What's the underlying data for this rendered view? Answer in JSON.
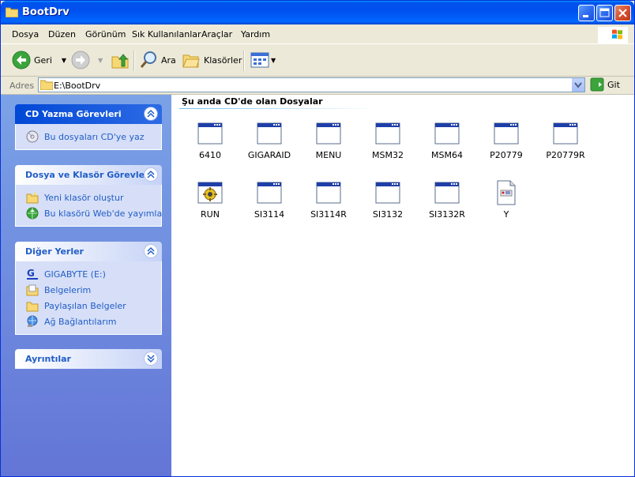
{
  "window": {
    "title": "BootDrv"
  },
  "menu": [
    "Dosya",
    "Düzen",
    "Görünüm",
    "Sık Kullanılanlar",
    "Araçlar",
    "Yardım"
  ],
  "toolbar": {
    "back_label": "Geri",
    "search_label": "Ara",
    "folders_label": "Klasörler"
  },
  "address": {
    "label": "Adres",
    "value": "E:\\BootDrv",
    "go_label": "Git"
  },
  "sidebar": {
    "panels": [
      {
        "title": "CD Yazma Görevleri",
        "items": [
          {
            "label": "Bu dosyaları CD'ye yaz",
            "icon": "cd-burn-icon"
          }
        ]
      },
      {
        "title": "Dosya ve Klasör Görevleri",
        "items": [
          {
            "label": "Yeni klasör oluştur",
            "icon": "new-folder-icon"
          },
          {
            "label": "Bu klasörü Web'de yayımla",
            "icon": "publish-web-icon"
          }
        ]
      },
      {
        "title": "Diğer Yerler",
        "items": [
          {
            "label": "GIGABYTE (E:)",
            "icon": "drive-icon"
          },
          {
            "label": "Belgelerim",
            "icon": "my-documents-icon"
          },
          {
            "label": "Paylaşılan Belgeler",
            "icon": "shared-documents-icon"
          },
          {
            "label": "Ağ Bağlantılarım",
            "icon": "network-icon"
          }
        ]
      },
      {
        "title": "Ayrıntılar",
        "items": []
      }
    ]
  },
  "content": {
    "group_title": "Şu anda CD'de olan Dosyalar",
    "files": [
      {
        "name": "6410",
        "type": "app"
      },
      {
        "name": "GIGARAID",
        "type": "app"
      },
      {
        "name": "MENU",
        "type": "app"
      },
      {
        "name": "MSM32",
        "type": "app"
      },
      {
        "name": "MSM64",
        "type": "app"
      },
      {
        "name": "P20779",
        "type": "app"
      },
      {
        "name": "P20779R",
        "type": "app"
      },
      {
        "name": "RUN",
        "type": "batch"
      },
      {
        "name": "SI3114",
        "type": "app"
      },
      {
        "name": "SI3114R",
        "type": "app"
      },
      {
        "name": "SI3132",
        "type": "app"
      },
      {
        "name": "SI3132R",
        "type": "app"
      },
      {
        "name": "Y",
        "type": "config"
      }
    ]
  }
}
